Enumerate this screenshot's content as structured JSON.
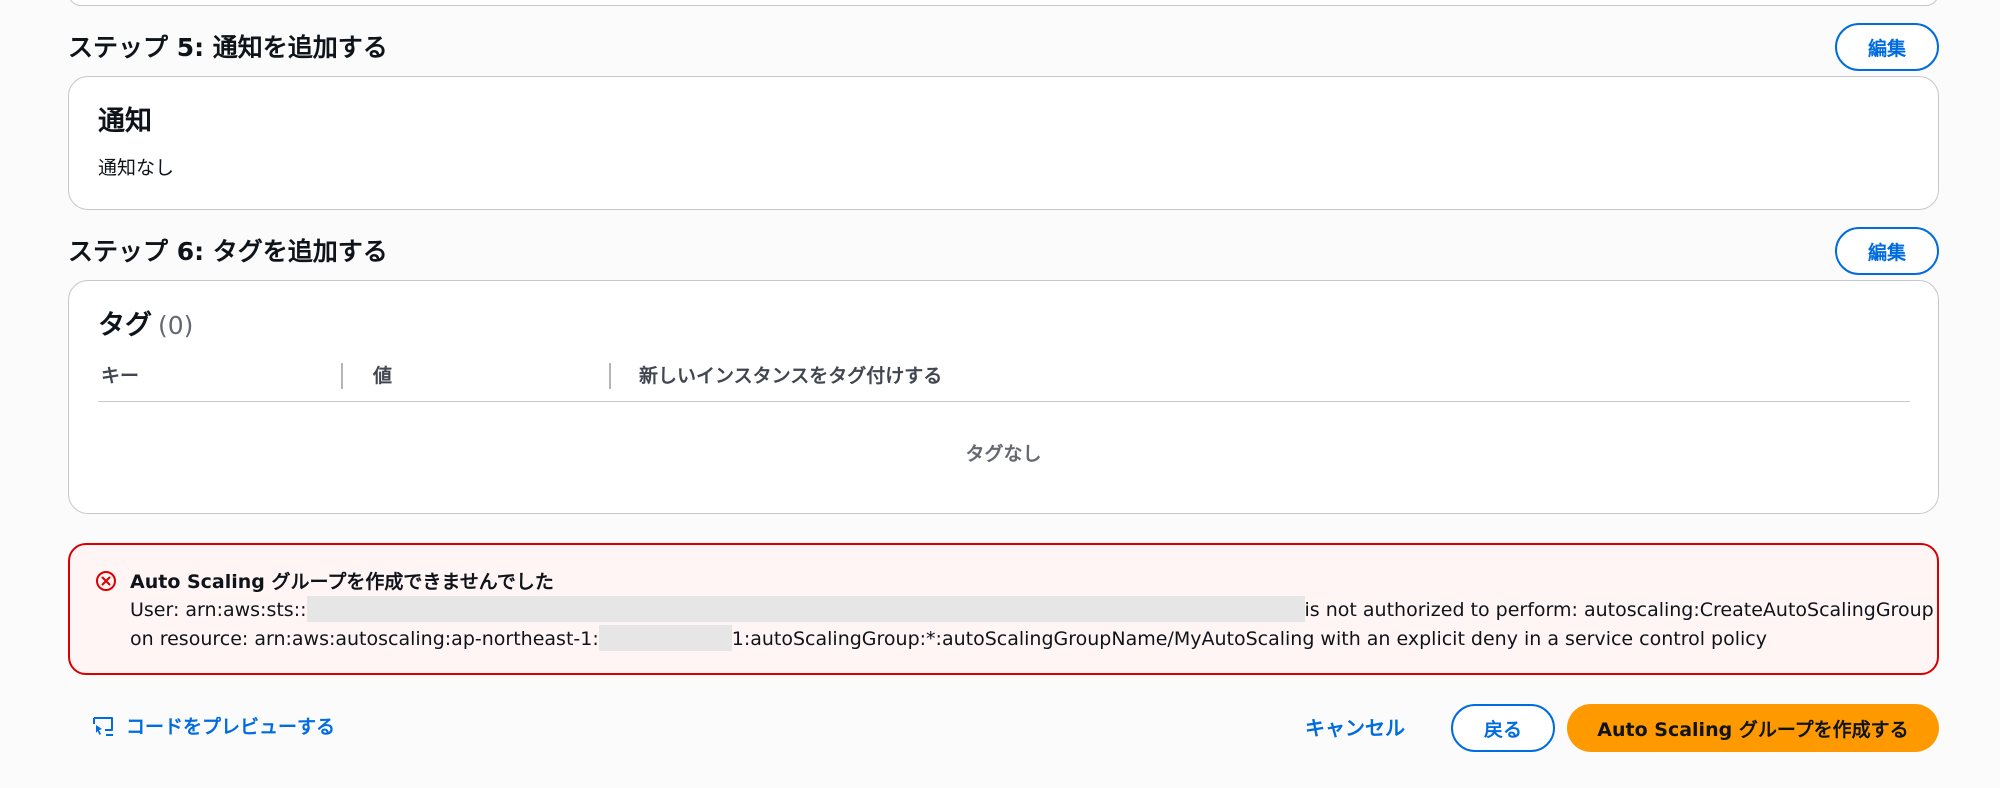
{
  "step5": {
    "title": "ステップ 5: 通知を追加する",
    "edit_label": "編集",
    "card_title": "通知",
    "card_text": "通知なし"
  },
  "step6": {
    "title": "ステップ 6: タグを追加する",
    "edit_label": "編集",
    "card_title": "タグ",
    "count": "(0)",
    "columns": [
      "キー",
      "値",
      "新しいインスタンスをタグ付けする"
    ],
    "empty_text": "タグなし"
  },
  "alert": {
    "title": "Auto Scaling グループを作成できませんでした",
    "line1_prefix": "User: arn:aws:sts::",
    "line1_suffix": "is not authorized to perform: autoscaling:CreateAutoScalingGroup",
    "line2_prefix": "on resource: arn:aws:autoscaling:ap-northeast-1:",
    "line2_suffix": "1:autoScalingGroup:*:autoScalingGroupName/MyAutoScaling with an explicit deny in a service control policy",
    "status_color": "#db0000"
  },
  "footer": {
    "preview_code_label": "コードをプレビューする",
    "cancel_label": "キャンセル",
    "back_label": "戻る",
    "create_label": "Auto Scaling グループを作成する",
    "accent_color": "#006ce0",
    "primary_color": "#ff9900"
  }
}
